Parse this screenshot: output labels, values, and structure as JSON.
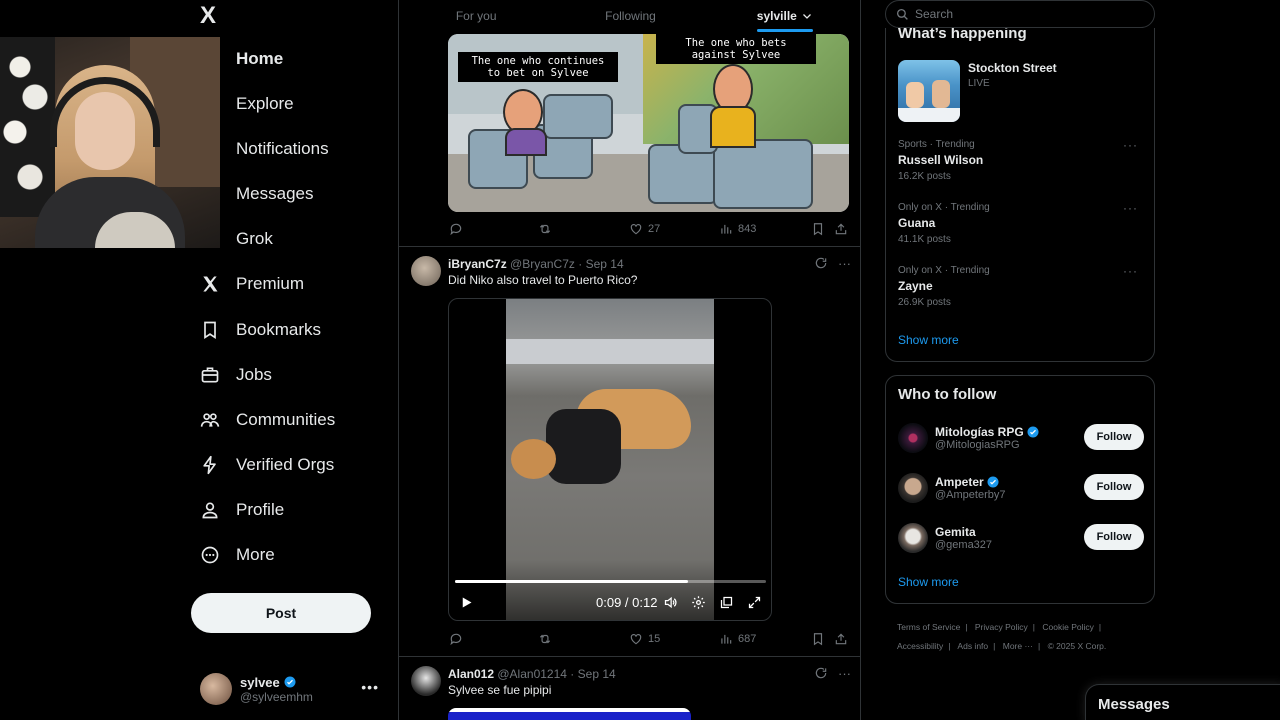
{
  "nav": {
    "logo": "X",
    "items": [
      {
        "label": "Home",
        "icon": "home-icon"
      },
      {
        "label": "Explore",
        "icon": "explore-icon"
      },
      {
        "label": "Notifications",
        "icon": "bell-icon"
      },
      {
        "label": "Messages",
        "icon": "mail-icon"
      },
      {
        "label": "Grok",
        "icon": "grok-icon"
      },
      {
        "label": "Premium",
        "icon": "x-icon"
      },
      {
        "label": "Bookmarks",
        "icon": "bookmark-icon"
      },
      {
        "label": "Jobs",
        "icon": "briefcase-icon"
      },
      {
        "label": "Communities",
        "icon": "people-icon"
      },
      {
        "label": "Verified Orgs",
        "icon": "lightning-icon"
      },
      {
        "label": "Profile",
        "icon": "person-icon"
      },
      {
        "label": "More",
        "icon": "more-circle-icon"
      }
    ],
    "post_button": "Post",
    "account": {
      "name": "sylvee",
      "handle": "@sylveemhm"
    }
  },
  "tabs": [
    {
      "label": "For you",
      "active": false
    },
    {
      "label": "Following",
      "active": false
    },
    {
      "label": "sylville",
      "active": true
    }
  ],
  "meme_post": {
    "caption_left": "The one who continues to bet on Sylvee",
    "caption_right": "The one who bets against Sylvee",
    "likes": "27",
    "views": "843"
  },
  "post2": {
    "name": "iBryanC7z",
    "handle": "@BryanC7z",
    "date": "Sep 14",
    "text": "Did Niko also travel to Puerto Rico?",
    "video_time": "0:09 / 0:12",
    "video_progress": 0.75,
    "likes": "15",
    "views": "687"
  },
  "post3": {
    "name": "Alan012",
    "handle": "@Alan01214",
    "date": "Sep 14",
    "text": "Sylvee se fue pipipi"
  },
  "search": {
    "placeholder": "Search"
  },
  "happening": {
    "title": "What’s happening",
    "live": {
      "name": "Stockton Street",
      "status": "LIVE"
    },
    "trends": [
      {
        "context": "Sports · Trending",
        "name": "Russell Wilson",
        "count": "16.2K posts"
      },
      {
        "context": "Only on X · Trending",
        "name": "Guana",
        "count": "41.1K posts"
      },
      {
        "context": "Only on X · Trending",
        "name": "Zayne",
        "count": "26.9K posts"
      }
    ],
    "show_more": "Show more"
  },
  "who_to_follow": {
    "title": "Who to follow",
    "accounts": [
      {
        "name": "Mitologías RPG",
        "handle": "@MitologiasRPG",
        "button": "Follow"
      },
      {
        "name": "Ampeter",
        "handle": "@Ampeterby7",
        "button": "Follow"
      },
      {
        "name": "Gemita",
        "handle": "@gema327",
        "button": "Follow"
      }
    ],
    "show_more": "Show more"
  },
  "footer": {
    "links": [
      "Terms of Service",
      "Privacy Policy",
      "Cookie Policy",
      "Accessibility",
      "Ads info",
      "More ···",
      "© 2025 X Corp."
    ]
  },
  "messages_dock": "Messages",
  "colors": {
    "accent": "#1d9bf0",
    "background": "#000000",
    "border": "#2f3336",
    "muted": "#71767b"
  }
}
